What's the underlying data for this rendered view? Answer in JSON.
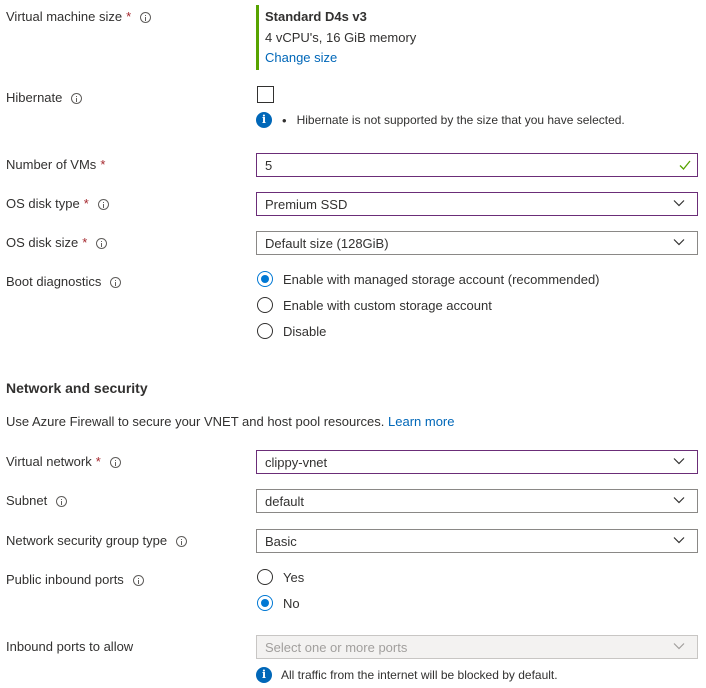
{
  "vm_size": {
    "label": "Virtual machine size",
    "required": "*",
    "size_name": "Standard D4s v3",
    "size_desc": "4 vCPU's, 16 GiB memory",
    "change_link": "Change size"
  },
  "hibernate": {
    "label": "Hibernate",
    "checked": false,
    "note_bullet": "•",
    "note": "Hibernate is not supported by the size that you have selected."
  },
  "num_vms": {
    "label": "Number of VMs",
    "required": "*",
    "value": "5"
  },
  "os_disk_type": {
    "label": "OS disk type",
    "required": "*",
    "value": "Premium SSD"
  },
  "os_disk_size": {
    "label": "OS disk size",
    "required": "*",
    "value": "Default size (128GiB)"
  },
  "boot_diagnostics": {
    "label": "Boot diagnostics",
    "options": [
      {
        "label": "Enable with managed storage account (recommended)",
        "selected": true
      },
      {
        "label": "Enable with custom storage account",
        "selected": false
      },
      {
        "label": "Disable",
        "selected": false
      }
    ]
  },
  "network_section": {
    "title": "Network and security",
    "description": "Use Azure Firewall to secure your VNET and host pool resources.",
    "learn_more": "Learn more"
  },
  "virtual_network": {
    "label": "Virtual network",
    "required": "*",
    "value": "clippy-vnet"
  },
  "subnet": {
    "label": "Subnet",
    "value": "default"
  },
  "nsg_type": {
    "label": "Network security group type",
    "value": "Basic"
  },
  "public_inbound": {
    "label": "Public inbound ports",
    "options": [
      {
        "label": "Yes",
        "selected": false
      },
      {
        "label": "No",
        "selected": true
      }
    ]
  },
  "inbound_ports": {
    "label": "Inbound ports to allow",
    "placeholder": "Select one or more ports",
    "note": "All traffic from the internet will be blocked by default."
  },
  "colors": {
    "accent": "#0078d4",
    "link": "#0067b8",
    "required": "#a4262c",
    "size_bar": "#57a300",
    "valid_check": "#57a300",
    "validated_border": "#6b2d78"
  }
}
